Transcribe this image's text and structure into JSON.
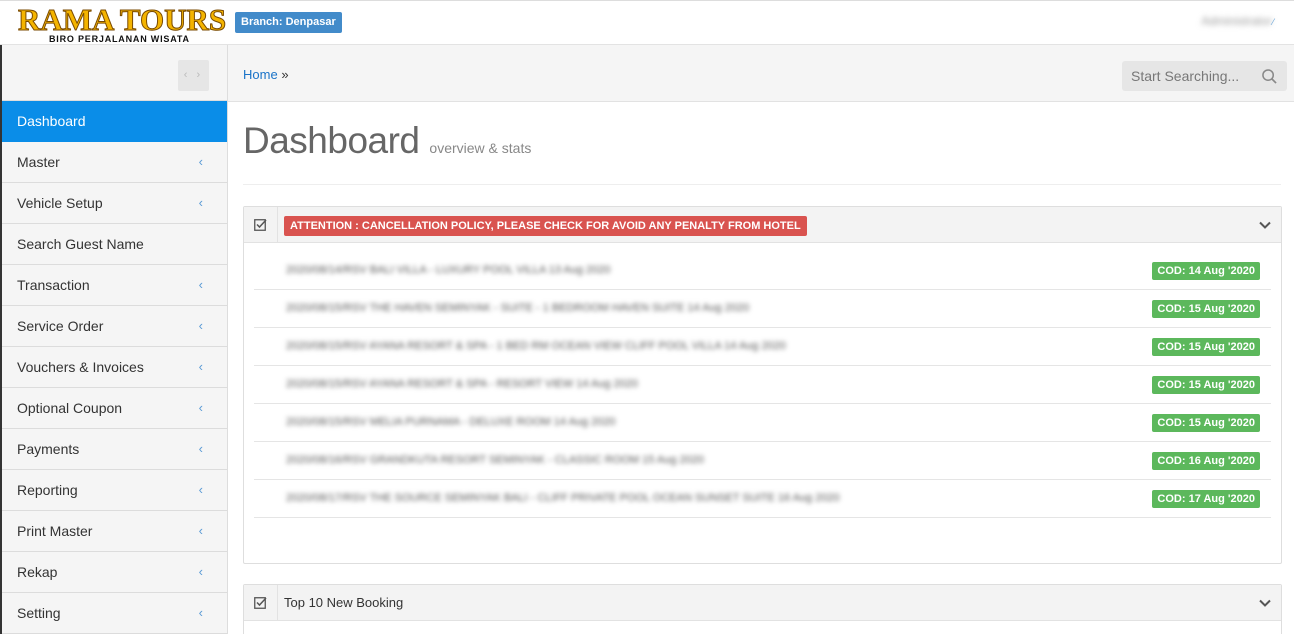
{
  "header": {
    "logo_main": "RAMA TOURS",
    "logo_sub": "BIRO PERJALANAN WISATA",
    "branch": "Branch: Denpasar",
    "user": "Administrator"
  },
  "sidebar": {
    "items": [
      {
        "label": "Dashboard",
        "active": true,
        "has_submenu": false
      },
      {
        "label": "Master",
        "has_submenu": true
      },
      {
        "label": "Vehicle Setup",
        "has_submenu": true
      },
      {
        "label": "Search Guest Name",
        "has_submenu": false
      },
      {
        "label": "Transaction",
        "has_submenu": true
      },
      {
        "label": "Service Order",
        "has_submenu": true
      },
      {
        "label": "Vouchers & Invoices",
        "has_submenu": true
      },
      {
        "label": "Optional Coupon",
        "has_submenu": true
      },
      {
        "label": "Payments",
        "has_submenu": true
      },
      {
        "label": "Reporting",
        "has_submenu": true
      },
      {
        "label": "Print Master",
        "has_submenu": true
      },
      {
        "label": "Rekap",
        "has_submenu": true
      },
      {
        "label": "Setting",
        "has_submenu": true
      }
    ]
  },
  "breadcrumb": {
    "home": "Home",
    "separator": "»"
  },
  "search": {
    "placeholder": "Start Searching..."
  },
  "page": {
    "title": "Dashboard",
    "subtitle": "overview & stats"
  },
  "cancellation_portlet": {
    "title": "ATTENTION : CANCELLATION POLICY, PLEASE CHECK FOR AVOID ANY PENALTY FROM HOTEL",
    "rows": [
      {
        "text": "2020/08/14/RSV BALI VILLA - LUXURY POOL VILLA 13 Aug 2020",
        "cod": "COD: 14 Aug '2020"
      },
      {
        "text": "2020/08/15/RSV THE HAVEN SEMINYAK - SUITE - 1 BEDROOM HAVEN SUITE 14 Aug 2020",
        "cod": "COD: 15 Aug '2020"
      },
      {
        "text": "2020/08/15/RSV AYANA RESORT & SPA - 1 BED RM OCEAN VIEW CLIFF POOL VILLA 14 Aug 2020",
        "cod": "COD: 15 Aug '2020"
      },
      {
        "text": "2020/08/15/RSV AYANA RESORT & SPA - RESORT VIEW 14 Aug 2020",
        "cod": "COD: 15 Aug '2020"
      },
      {
        "text": "2020/08/15/RSV MELIA PURNAMA - DELUXE ROOM 14 Aug 2020",
        "cod": "COD: 15 Aug '2020"
      },
      {
        "text": "2020/08/16/RSV GRANDKUTA RESORT SEMINYAK - CLASSIC ROOM 15 Aug 2020",
        "cod": "COD: 16 Aug '2020"
      },
      {
        "text": "2020/08/17/RSV THE SOURCE SEMINYAK BALI - CLIFF PRIVATE POOL OCEAN SUNSET SUITE 16 Aug 2020",
        "cod": "COD: 17 Aug '2020"
      }
    ]
  },
  "booking_portlet": {
    "title": "Top 10 New Booking"
  },
  "colors": {
    "brand_blue": "#0a8de8",
    "branch_badge": "#428bca",
    "alert_red": "#d9534f",
    "badge_green": "#5cb85c",
    "logo_gold": "#f4b400"
  }
}
